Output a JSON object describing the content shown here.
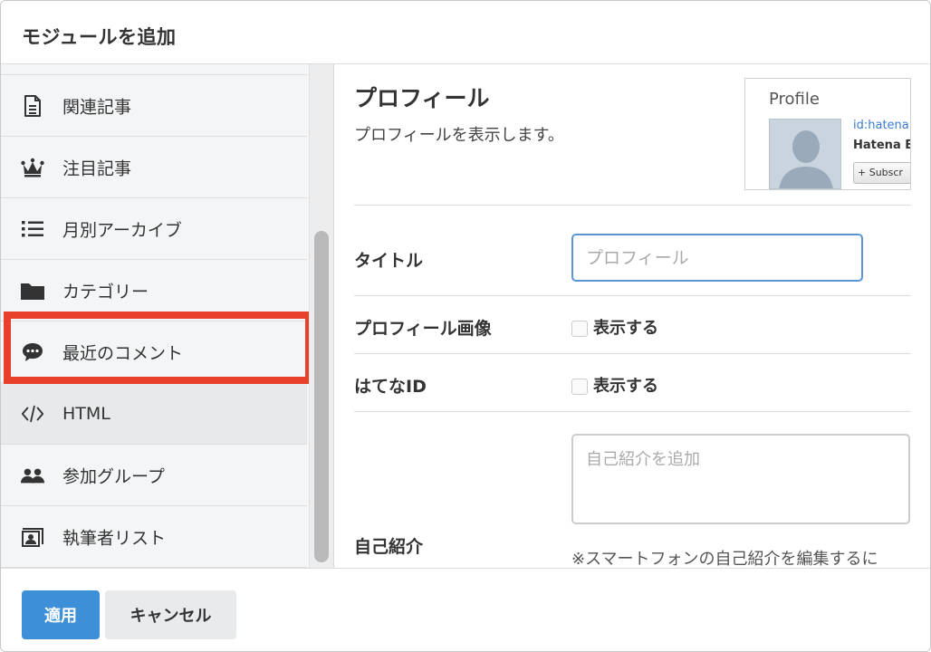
{
  "dialog": {
    "title": "モジュールを追加"
  },
  "sidebar": {
    "items": [
      {
        "label": "関連記事",
        "icon": "document-icon"
      },
      {
        "label": "注目記事",
        "icon": "crown-icon"
      },
      {
        "label": "月別アーカイブ",
        "icon": "list-icon"
      },
      {
        "label": "カテゴリー",
        "icon": "folder-icon"
      },
      {
        "label": "最近のコメント",
        "icon": "comment-icon"
      },
      {
        "label": "HTML",
        "icon": "code-icon",
        "selected": true
      },
      {
        "label": "参加グループ",
        "icon": "group-icon"
      },
      {
        "label": "執筆者リスト",
        "icon": "author-card-icon"
      }
    ]
  },
  "module": {
    "title": "プロフィール",
    "description": "プロフィールを表示します。",
    "preview": {
      "title": "Profile",
      "link": "id:hatena",
      "name": "Hatena B",
      "subscribe": "+ Subscr"
    }
  },
  "form": {
    "title_label": "タイトル",
    "title_placeholder": "プロフィール",
    "image_label": "プロフィール画像",
    "image_checkbox_label": "表示する",
    "hatena_id_label": "はてなID",
    "hatena_id_checkbox_label": "表示する",
    "intro_label": "自己紹介",
    "intro_placeholder": "自己紹介を追加",
    "intro_note": "※スマートフォンの自己紹介を編集するに"
  },
  "footer": {
    "apply_label": "適用",
    "cancel_label": "キャンセル"
  },
  "colors": {
    "accent": "#3d8fd8",
    "highlight_border": "#e8402a",
    "input_focus": "#5b95d6"
  }
}
